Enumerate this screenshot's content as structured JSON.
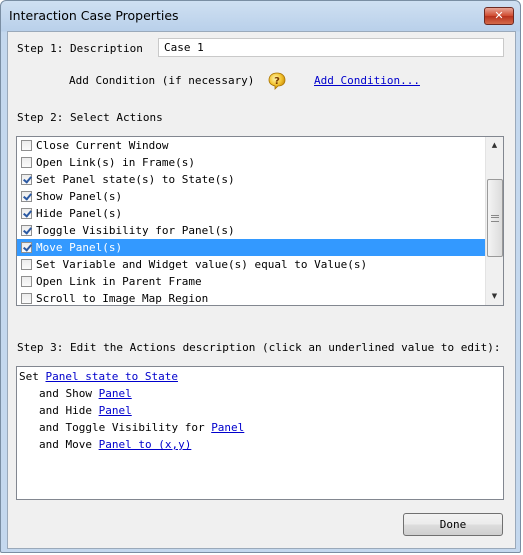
{
  "window": {
    "title": "Interaction Case Properties",
    "close_glyph": "✕"
  },
  "step1": {
    "label": "Step 1: Description",
    "description_value": "Case 1",
    "add_condition_text": "Add Condition (if necessary)",
    "add_condition_link": "Add Condition...",
    "help_icon": "question-mark-icon"
  },
  "step2": {
    "label": "Step 2: Select Actions",
    "actions": [
      {
        "label": "Close Current Window",
        "checked": false,
        "selected": false
      },
      {
        "label": "Open Link(s) in Frame(s)",
        "checked": false,
        "selected": false
      },
      {
        "label": "Set Panel state(s) to State(s)",
        "checked": true,
        "selected": false
      },
      {
        "label": "Show Panel(s)",
        "checked": true,
        "selected": false
      },
      {
        "label": "Hide Panel(s)",
        "checked": true,
        "selected": false
      },
      {
        "label": "Toggle Visibility for Panel(s)",
        "checked": true,
        "selected": false
      },
      {
        "label": "Move Panel(s)",
        "checked": true,
        "selected": true
      },
      {
        "label": "Set Variable and Widget value(s) equal to Value(s)",
        "checked": false,
        "selected": false
      },
      {
        "label": "Open Link in Parent Frame",
        "checked": false,
        "selected": false
      },
      {
        "label": "Scroll to Image Map Region",
        "checked": false,
        "selected": false
      }
    ],
    "scroll_up": "▲",
    "scroll_down": "▼"
  },
  "step3": {
    "label": "Step 3: Edit the Actions description (click an underlined value to edit):",
    "lines": [
      {
        "prefix": "Set ",
        "link": "Panel state to State"
      },
      {
        "prefix": "and Show ",
        "link": "Panel"
      },
      {
        "prefix": "and Hide ",
        "link": "Panel"
      },
      {
        "prefix": "and Toggle Visibility for ",
        "link": "Panel"
      },
      {
        "prefix": "and Move ",
        "link": "Panel to (x,y)"
      }
    ]
  },
  "footer": {
    "done_label": "Done"
  },
  "colors": {
    "selection": "#3399ff",
    "link": "#0000cc",
    "close_button": "#cf4a2f"
  }
}
